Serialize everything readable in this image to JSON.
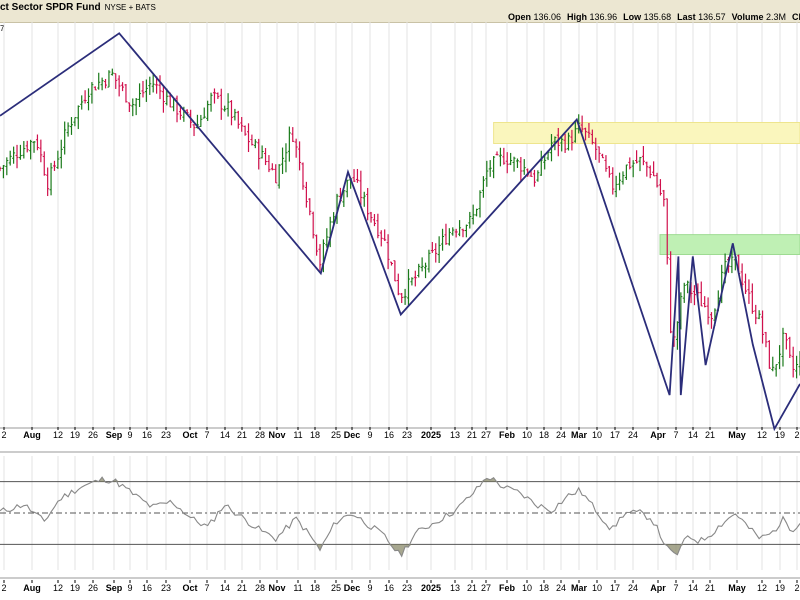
{
  "header": {
    "title": "ct Sector SPDR Fund",
    "exchange": "NYSE + BATS",
    "fields": [
      {
        "label": "Open",
        "value": "136.06"
      },
      {
        "label": "High",
        "value": "136.96"
      },
      {
        "label": "Low",
        "value": "135.68"
      },
      {
        "label": "Last",
        "value": "136.57"
      },
      {
        "label": "Volume",
        "value": "2.3M"
      },
      {
        "label": "Ch",
        "value": ""
      }
    ],
    "legend_edge": "7"
  },
  "colors": {
    "up": "#1a7a1a",
    "down": "#d0104c",
    "zigzag": "#2b2d7a",
    "resistance_zone": "#faf6bd",
    "support_zone": "#bff0b4",
    "header_bg": "#ece7d2",
    "grid": "#e3e3e3",
    "indicator_line": "#888888",
    "indicator_fill": "#8a8a6a"
  },
  "chart_data": [
    {
      "type": "ohlc",
      "x_axis": {
        "labels": [
          {
            "text": "2",
            "major": false
          },
          {
            "text": "Aug",
            "major": true
          },
          {
            "text": "12",
            "major": false
          },
          {
            "text": "19",
            "major": false
          },
          {
            "text": "26",
            "major": false
          },
          {
            "text": "Sep",
            "major": true
          },
          {
            "text": "9",
            "major": false
          },
          {
            "text": "16",
            "major": false
          },
          {
            "text": "23",
            "major": false
          },
          {
            "text": "Oct",
            "major": true
          },
          {
            "text": "7",
            "major": false
          },
          {
            "text": "14",
            "major": false
          },
          {
            "text": "21",
            "major": false
          },
          {
            "text": "28",
            "major": false
          },
          {
            "text": "Nov",
            "major": true
          },
          {
            "text": "11",
            "major": false
          },
          {
            "text": "18",
            "major": false
          },
          {
            "text": "25",
            "major": false
          },
          {
            "text": "Dec",
            "major": true
          },
          {
            "text": "9",
            "major": false
          },
          {
            "text": "16",
            "major": false
          },
          {
            "text": "23",
            "major": false
          },
          {
            "text": "2025",
            "major": true
          },
          {
            "text": "13",
            "major": false
          },
          {
            "text": "21",
            "major": false
          },
          {
            "text": "27",
            "major": false
          },
          {
            "text": "Feb",
            "major": true
          },
          {
            "text": "10",
            "major": false
          },
          {
            "text": "18",
            "major": false
          },
          {
            "text": "24",
            "major": false
          },
          {
            "text": "Mar",
            "major": true
          },
          {
            "text": "10",
            "major": false
          },
          {
            "text": "17",
            "major": false
          },
          {
            "text": "24",
            "major": false
          },
          {
            "text": "Apr",
            "major": true
          },
          {
            "text": "7",
            "major": false
          },
          {
            "text": "14",
            "major": false
          },
          {
            "text": "21",
            "major": false
          },
          {
            "text": "May",
            "major": true
          },
          {
            "text": "12",
            "major": false
          },
          {
            "text": "19",
            "major": false
          },
          {
            "text": "2",
            "major": false
          }
        ],
        "positions": [
          4,
          32,
          58,
          75,
          93,
          114,
          130,
          147,
          166,
          190,
          207,
          225,
          242,
          260,
          277,
          298,
          315,
          336,
          352,
          370,
          389,
          407,
          431,
          455,
          472,
          486,
          507,
          527,
          544,
          561,
          579,
          597,
          615,
          633,
          658,
          676,
          693,
          710,
          737,
          762,
          780,
          797
        ]
      },
      "price_y_range": [
        0,
        100
      ],
      "zones": [
        {
          "name": "resistance",
          "x_start": 0.617,
          "x_end": 1.0,
          "y_low": 75.6,
          "y_high": 81.2
        },
        {
          "name": "support",
          "x_start": 0.825,
          "x_end": 1.0,
          "y_low": 46.0,
          "y_high": 51.3
        }
      ],
      "zigzag": [
        {
          "x": 0.0,
          "y": 83
        },
        {
          "x": 0.149,
          "y": 105
        },
        {
          "x": 0.401,
          "y": 41
        },
        {
          "x": 0.435,
          "y": 68
        },
        {
          "x": 0.501,
          "y": 30
        },
        {
          "x": 0.721,
          "y": 82
        },
        {
          "x": 0.837,
          "y": 8.5
        },
        {
          "x": 0.848,
          "y": 45.5
        },
        {
          "x": 0.851,
          "y": 8.5
        },
        {
          "x": 0.866,
          "y": 45.5
        },
        {
          "x": 0.882,
          "y": 16.5
        },
        {
          "x": 0.916,
          "y": 49
        },
        {
          "x": 0.941,
          "y": 22
        },
        {
          "x": 0.968,
          "y": -0.5
        },
        {
          "x": 1.0,
          "y": 11.5
        }
      ],
      "bars_profile": [
        {
          "x": 0.0,
          "y": 69
        },
        {
          "x": 0.02,
          "y": 73
        },
        {
          "x": 0.045,
          "y": 77
        },
        {
          "x": 0.06,
          "y": 65
        },
        {
          "x": 0.085,
          "y": 80
        },
        {
          "x": 0.11,
          "y": 90
        },
        {
          "x": 0.14,
          "y": 94
        },
        {
          "x": 0.165,
          "y": 86
        },
        {
          "x": 0.19,
          "y": 92
        },
        {
          "x": 0.215,
          "y": 86
        },
        {
          "x": 0.245,
          "y": 80
        },
        {
          "x": 0.265,
          "y": 88
        },
        {
          "x": 0.285,
          "y": 85
        },
        {
          "x": 0.305,
          "y": 78
        },
        {
          "x": 0.325,
          "y": 73
        },
        {
          "x": 0.345,
          "y": 67
        },
        {
          "x": 0.365,
          "y": 79
        },
        {
          "x": 0.38,
          "y": 65
        },
        {
          "x": 0.4,
          "y": 44
        },
        {
          "x": 0.42,
          "y": 60
        },
        {
          "x": 0.44,
          "y": 67
        },
        {
          "x": 0.46,
          "y": 58
        },
        {
          "x": 0.48,
          "y": 50
        },
        {
          "x": 0.5,
          "y": 35
        },
        {
          "x": 0.52,
          "y": 40
        },
        {
          "x": 0.545,
          "y": 47
        },
        {
          "x": 0.565,
          "y": 53
        },
        {
          "x": 0.59,
          "y": 55
        },
        {
          "x": 0.61,
          "y": 69
        },
        {
          "x": 0.63,
          "y": 72
        },
        {
          "x": 0.65,
          "y": 70
        },
        {
          "x": 0.67,
          "y": 66
        },
        {
          "x": 0.69,
          "y": 76
        },
        {
          "x": 0.71,
          "y": 76
        },
        {
          "x": 0.725,
          "y": 80
        },
        {
          "x": 0.745,
          "y": 74
        },
        {
          "x": 0.765,
          "y": 64
        },
        {
          "x": 0.785,
          "y": 70
        },
        {
          "x": 0.8,
          "y": 71
        },
        {
          "x": 0.815,
          "y": 68
        },
        {
          "x": 0.83,
          "y": 60
        },
        {
          "x": 0.84,
          "y": 20
        },
        {
          "x": 0.855,
          "y": 38
        },
        {
          "x": 0.87,
          "y": 35
        },
        {
          "x": 0.89,
          "y": 30
        },
        {
          "x": 0.905,
          "y": 42
        },
        {
          "x": 0.92,
          "y": 44
        },
        {
          "x": 0.935,
          "y": 35
        },
        {
          "x": 0.95,
          "y": 28
        },
        {
          "x": 0.965,
          "y": 14
        },
        {
          "x": 0.98,
          "y": 24
        },
        {
          "x": 0.99,
          "y": 15
        },
        {
          "x": 1.0,
          "y": 17
        }
      ]
    },
    {
      "type": "line",
      "name": "",
      "y_range": [
        -1,
        1
      ],
      "upper": 0.55,
      "middle": 0.0,
      "lower": -0.55,
      "series_profile": [
        {
          "x": 0.0,
          "y": 0.02
        },
        {
          "x": 0.03,
          "y": 0.15
        },
        {
          "x": 0.055,
          "y": -0.15
        },
        {
          "x": 0.075,
          "y": 0.25
        },
        {
          "x": 0.1,
          "y": 0.45
        },
        {
          "x": 0.13,
          "y": 0.6
        },
        {
          "x": 0.145,
          "y": 0.55
        },
        {
          "x": 0.165,
          "y": 0.35
        },
        {
          "x": 0.19,
          "y": 0.1
        },
        {
          "x": 0.215,
          "y": 0.2
        },
        {
          "x": 0.24,
          "y": -0.1
        },
        {
          "x": 0.26,
          "y": -0.25
        },
        {
          "x": 0.28,
          "y": 0.15
        },
        {
          "x": 0.3,
          "y": -0.05
        },
        {
          "x": 0.325,
          "y": -0.3
        },
        {
          "x": 0.345,
          "y": -0.45
        },
        {
          "x": 0.37,
          "y": -0.1
        },
        {
          "x": 0.385,
          "y": -0.35
        },
        {
          "x": 0.4,
          "y": -0.65
        },
        {
          "x": 0.42,
          "y": -0.15
        },
        {
          "x": 0.44,
          "y": 0.0
        },
        {
          "x": 0.46,
          "y": -0.2
        },
        {
          "x": 0.48,
          "y": -0.4
        },
        {
          "x": 0.5,
          "y": -0.75
        },
        {
          "x": 0.52,
          "y": -0.35
        },
        {
          "x": 0.545,
          "y": -0.15
        },
        {
          "x": 0.57,
          "y": 0.05
        },
        {
          "x": 0.595,
          "y": 0.4
        },
        {
          "x": 0.61,
          "y": 0.65
        },
        {
          "x": 0.63,
          "y": 0.45
        },
        {
          "x": 0.65,
          "y": 0.35
        },
        {
          "x": 0.67,
          "y": 0.15
        },
        {
          "x": 0.69,
          "y": 0.05
        },
        {
          "x": 0.71,
          "y": 0.3
        },
        {
          "x": 0.725,
          "y": 0.4
        },
        {
          "x": 0.745,
          "y": 0.05
        },
        {
          "x": 0.765,
          "y": -0.3
        },
        {
          "x": 0.78,
          "y": 0.0
        },
        {
          "x": 0.8,
          "y": 0.0
        },
        {
          "x": 0.815,
          "y": -0.1
        },
        {
          "x": 0.835,
          "y": -0.65
        },
        {
          "x": 0.845,
          "y": -0.75
        },
        {
          "x": 0.86,
          "y": -0.4
        },
        {
          "x": 0.875,
          "y": -0.5
        },
        {
          "x": 0.89,
          "y": -0.35
        },
        {
          "x": 0.905,
          "y": -0.15
        },
        {
          "x": 0.92,
          "y": 0.0
        },
        {
          "x": 0.935,
          "y": -0.25
        },
        {
          "x": 0.95,
          "y": -0.45
        },
        {
          "x": 0.965,
          "y": -0.35
        },
        {
          "x": 0.98,
          "y": -0.1
        },
        {
          "x": 0.99,
          "y": -0.3
        },
        {
          "x": 1.0,
          "y": -0.15
        }
      ]
    }
  ]
}
